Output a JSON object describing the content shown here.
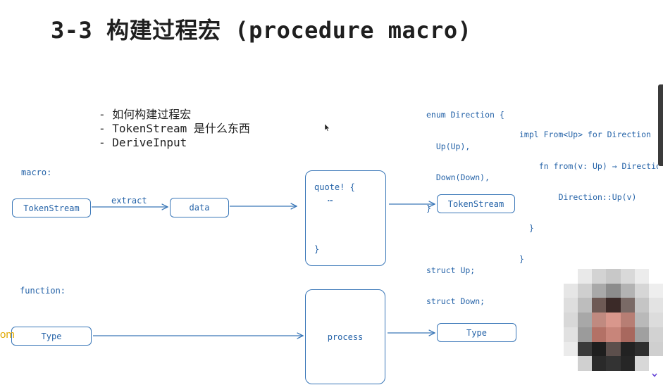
{
  "title": "3-3 构建过程宏 (procedure macro)",
  "bullets": [
    "- 如何构建过程宏",
    "- TokenStream 是什么东西",
    "- DeriveInput"
  ],
  "diagram": {
    "macro_label": "macro:",
    "function_label": "function:",
    "macro_row": {
      "input": "TokenStream",
      "edge_label": "extract",
      "middle": "data",
      "quote_open": "quote! {",
      "quote_body": "…",
      "quote_close": "}",
      "output": "TokenStream"
    },
    "function_row": {
      "input": "Type",
      "process": "process",
      "output": "Type"
    }
  },
  "code": {
    "enum_block": [
      "enum Direction {",
      "  Up(Up),",
      "  Down(Down),",
      "}",
      "",
      "struct Up;",
      "struct Down;"
    ],
    "impl_block": [
      "impl From<Up> for Direction",
      "  fn from(v: Up) → Directio",
      "     Direction::Up(v)",
      "  }",
      "}"
    ]
  },
  "overlay": {
    "edge_text": "om"
  },
  "colors": {
    "diagram_blue": "#2563a8",
    "title": "#1f1f1f",
    "overlay_text": "#e0a800"
  },
  "icons": [
    "mouse-cursor-icon",
    "chevron-down-icon"
  ]
}
